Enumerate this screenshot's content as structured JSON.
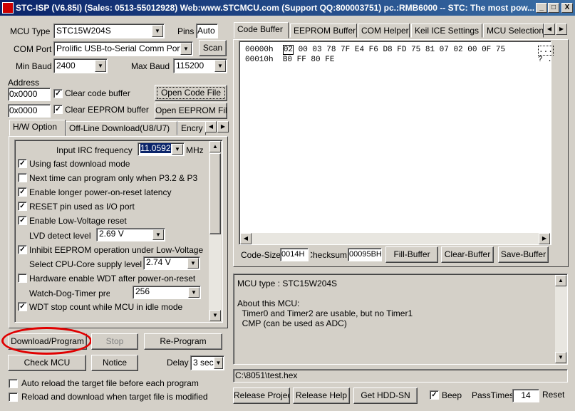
{
  "window": {
    "title": "STC-ISP (V6.85I) (Sales: 0513-55012928) Web:www.STCMCU.com  (Support QQ:800003751)  pc.:RMB6000 -- STC: The most pow...",
    "min_label": "_",
    "max_label": "□",
    "close_label": "X"
  },
  "left": {
    "mcu_type_label": "MCU Type",
    "mcu_type_value": "STC15W204S",
    "pins_label": "Pins",
    "pins_value": "Auto",
    "com_port_label": "COM Port",
    "com_port_value": "Prolific USB-to-Serial Comm Port",
    "scan_label": "Scan",
    "min_baud_label": "Min Baud",
    "min_baud_value": "2400",
    "max_baud_label": "Max Baud",
    "max_baud_value": "115200",
    "address_label": "Address",
    "addr1_value": "0x0000",
    "clear_code_label": "Clear code buffer",
    "open_code_label": "Open Code File",
    "addr2_value": "0x0000",
    "clear_eeprom_label": "Clear EEPROM buffer",
    "open_eeprom_label": "Open EEPROM File",
    "tabs": [
      "H/W Option",
      "Off-Line Download(U8/U7)",
      "Encry"
    ],
    "options": {
      "irc_label": "Input IRC frequency",
      "irc_value": "11.0592",
      "irc_unit": "MHz",
      "fast_download": "Using fast download mode",
      "next_time": "Next time can program only when P3.2 & P3",
      "longer_reset": "Enable longer power-on-reset latency",
      "reset_pin": "RESET pin used as I/O port",
      "low_voltage": "Enable Low-Voltage reset",
      "lvd_label": "LVD detect level",
      "lvd_value": "2.69 V",
      "inhibit_eeprom": "Inhibit EEPROM operation under Low-Voltage",
      "cpu_level_label": "Select CPU-Core supply level",
      "cpu_level_value": "2.74 V",
      "hw_wdt": "Hardware enable WDT after power-on-reset",
      "wdt_prescale_label": "Watch-Dog-Timer prescale",
      "wdt_prescale_value": "256",
      "wdt_stop": "WDT stop count while MCU in idle mode"
    },
    "download_label": "Download/Program",
    "stop_label": "Stop",
    "reprogram_label": "Re-Program",
    "check_mcu_label": "Check MCU",
    "notice_label": "Notice",
    "delay_label": "Delay",
    "delay_value": "3 sec",
    "auto_reload_label": "Auto reload the target file before each program",
    "reload_download_label": "Reload and download when target file is modified"
  },
  "right": {
    "tabs": [
      "Code Buffer",
      "EEPROM Buffer",
      "COM Helper",
      "Keil ICE Settings",
      "MCU Selection"
    ],
    "hex_rows": [
      {
        "addr": "00000h",
        "first": "02",
        "bytes": "00 03 78 7F E4 F6 D8 FD 75 81 07 02 00 0F 75",
        "ascii": "..."
      },
      {
        "addr": "00010h",
        "first": "",
        "bytes": "B0 FF 80 FE",
        "ascii": "? ."
      }
    ],
    "code_size_label": "Code-Size",
    "code_size_value": "0014H",
    "checksum_label": "Checksum",
    "checksum_value": "00095BH",
    "fill_buffer_label": "Fill-Buffer",
    "clear_buffer_label": "Clear-Buffer",
    "save_buffer_label": "Save-Buffer",
    "info_lines": [
      "MCU type : STC15W204S",
      "",
      "About this MCU:",
      "  Timer0 and Timer2 are usable, but no Timer1",
      "  CMP (can be used as ADC)"
    ],
    "file_path": "C:\\8051\\test.hex",
    "release_project_label": "Release Project",
    "release_help_label": "Release Help",
    "get_hdd_label": "Get HDD-SN",
    "beep_label": "Beep",
    "pass_times_label": "PassTimes",
    "pass_times_value": "14",
    "reset_label": "Reset"
  },
  "colors": {
    "highlight_ellipse": "#e00000",
    "title_bar": "#0a246a"
  }
}
